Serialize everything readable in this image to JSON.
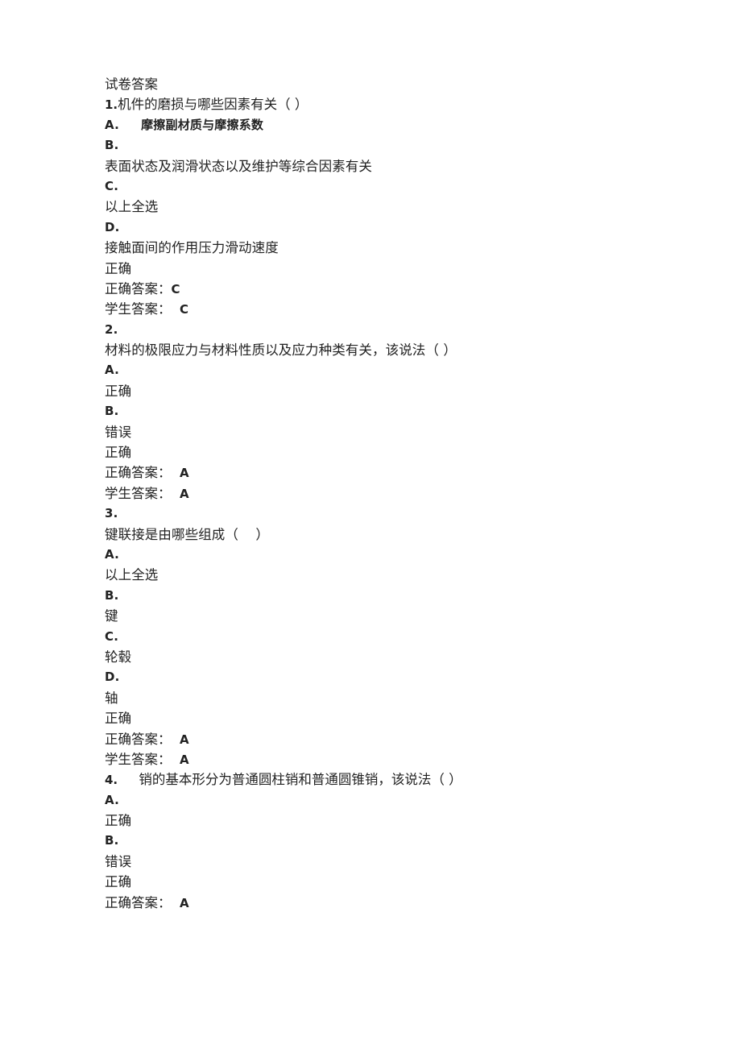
{
  "document": {
    "title": "试卷答案",
    "background_color": "#ffffff",
    "text_color": "#222222"
  },
  "lines": [
    {
      "id": "title",
      "kind": "title",
      "text": "试卷答案"
    },
    {
      "id": "q1-head",
      "kind": "qhead",
      "num": "1.",
      "text": "机件的磨损与哪些因素有关（ ）"
    },
    {
      "id": "q1-opt-a",
      "kind": "latin",
      "text": "A.     摩擦副材质与摩擦系数"
    },
    {
      "id": "q1-opt-b",
      "kind": "latin",
      "text": "B."
    },
    {
      "id": "q1-opt-b-txt",
      "kind": "cjk",
      "text": "表面状态及润滑状态以及维护等综合因素有关"
    },
    {
      "id": "q1-opt-c",
      "kind": "latin",
      "text": "C."
    },
    {
      "id": "q1-opt-c-txt",
      "kind": "cjk",
      "text": "以上全选"
    },
    {
      "id": "q1-opt-d",
      "kind": "latin",
      "text": "D."
    },
    {
      "id": "q1-opt-d-txt",
      "kind": "cjk",
      "text": "接触面间的作用压力滑动速度"
    },
    {
      "id": "q1-mark",
      "kind": "cjk",
      "text": "正确"
    },
    {
      "id": "q1-correct",
      "kind": "answer",
      "label": "正确答案：",
      "val": "C"
    },
    {
      "id": "q1-student",
      "kind": "answer",
      "label": "学生答案：",
      "val": "  C"
    },
    {
      "id": "q2-num",
      "kind": "latin",
      "text": "2."
    },
    {
      "id": "q2-head",
      "kind": "cjk",
      "text": "材料的极限应力与材料性质以及应力种类有关，该说法（ ）"
    },
    {
      "id": "q2-opt-a",
      "kind": "latin",
      "text": "A."
    },
    {
      "id": "q2-opt-a-txt",
      "kind": "cjk",
      "text": "正确"
    },
    {
      "id": "q2-opt-b",
      "kind": "latin",
      "text": "B."
    },
    {
      "id": "q2-opt-b-txt",
      "kind": "cjk",
      "text": "错误"
    },
    {
      "id": "q2-mark",
      "kind": "cjk",
      "text": "正确"
    },
    {
      "id": "q2-correct",
      "kind": "answer",
      "label": "正确答案：",
      "val": "  A"
    },
    {
      "id": "q2-student",
      "kind": "answer",
      "label": "学生答案：",
      "val": "  A"
    },
    {
      "id": "q3-num",
      "kind": "latin",
      "text": "3."
    },
    {
      "id": "q3-head",
      "kind": "cjk",
      "text": "键联接是由哪些组成（    ）"
    },
    {
      "id": "q3-opt-a",
      "kind": "latin",
      "text": "A."
    },
    {
      "id": "q3-opt-a-txt",
      "kind": "cjk",
      "text": "以上全选"
    },
    {
      "id": "q3-opt-b",
      "kind": "latin",
      "text": "B."
    },
    {
      "id": "q3-opt-b-txt",
      "kind": "cjk",
      "text": "键"
    },
    {
      "id": "q3-opt-c",
      "kind": "latin",
      "text": "C."
    },
    {
      "id": "q3-opt-c-txt",
      "kind": "cjk",
      "text": "轮毂"
    },
    {
      "id": "q3-opt-d",
      "kind": "latin",
      "text": "D."
    },
    {
      "id": "q3-opt-d-txt",
      "kind": "cjk",
      "text": "轴"
    },
    {
      "id": "q3-mark",
      "kind": "cjk",
      "text": "正确"
    },
    {
      "id": "q3-correct",
      "kind": "answer",
      "label": "正确答案：",
      "val": "  A"
    },
    {
      "id": "q3-student",
      "kind": "answer",
      "label": "学生答案：",
      "val": "  A"
    },
    {
      "id": "q4-head",
      "kind": "qhead",
      "num": "4.",
      "text": "     销的基本形分为普通圆柱销和普通圆锥销，该说法（ ）"
    },
    {
      "id": "q4-opt-a",
      "kind": "latin",
      "text": "A."
    },
    {
      "id": "q4-opt-a-txt",
      "kind": "cjk",
      "text": "正确"
    },
    {
      "id": "q4-opt-b",
      "kind": "latin",
      "text": "B."
    },
    {
      "id": "q4-opt-b-txt",
      "kind": "cjk",
      "text": "错误"
    },
    {
      "id": "q4-mark",
      "kind": "cjk",
      "text": "正确"
    },
    {
      "id": "q4-correct",
      "kind": "answer",
      "label": "正确答案：",
      "val": "  A"
    }
  ]
}
